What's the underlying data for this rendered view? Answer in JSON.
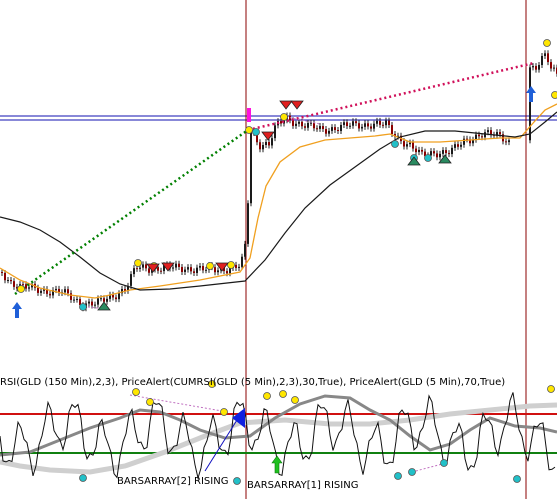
{
  "chart_data": [
    {
      "type": "candlestick",
      "panel": "price",
      "markers": {
        "buy_arrows": 2,
        "sell_triangles": 5
      },
      "colors": {
        "up_bar": "#1a1a1a",
        "down_bar": "#8b0000",
        "moving_average_fast": "#f0a020",
        "moving_average_slow": "#1a1a1a",
        "trend_link_left": "#008000",
        "trend_link_right": "#d0105a",
        "horizontal_lines": "#1010b0",
        "session_divider": "#8b0000",
        "buy_arrow": "#1f5fd8",
        "marker_yellow": "#ffe600",
        "marker_cyan": "#22c0c8"
      }
    },
    {
      "type": "line",
      "panel": "indicator",
      "label": "RSI(GLD (150 Min),2,3), PriceAlert(CUMRSI(GLD (5 Min),2,3),30,True), PriceAlert(GLD (5 Min),70,True)",
      "annotations": [
        "BARSARRAY[2] RISING",
        "BARSARRAY[1] RISING"
      ],
      "reference_lines": [
        {
          "name": "upper",
          "color": "#d01010"
        },
        {
          "name": "lower",
          "color": "#108010"
        }
      ],
      "series": [
        {
          "color": "#111111"
        },
        {
          "color": "#888888"
        },
        {
          "color": "#cfcfcf"
        }
      ]
    }
  ]
}
